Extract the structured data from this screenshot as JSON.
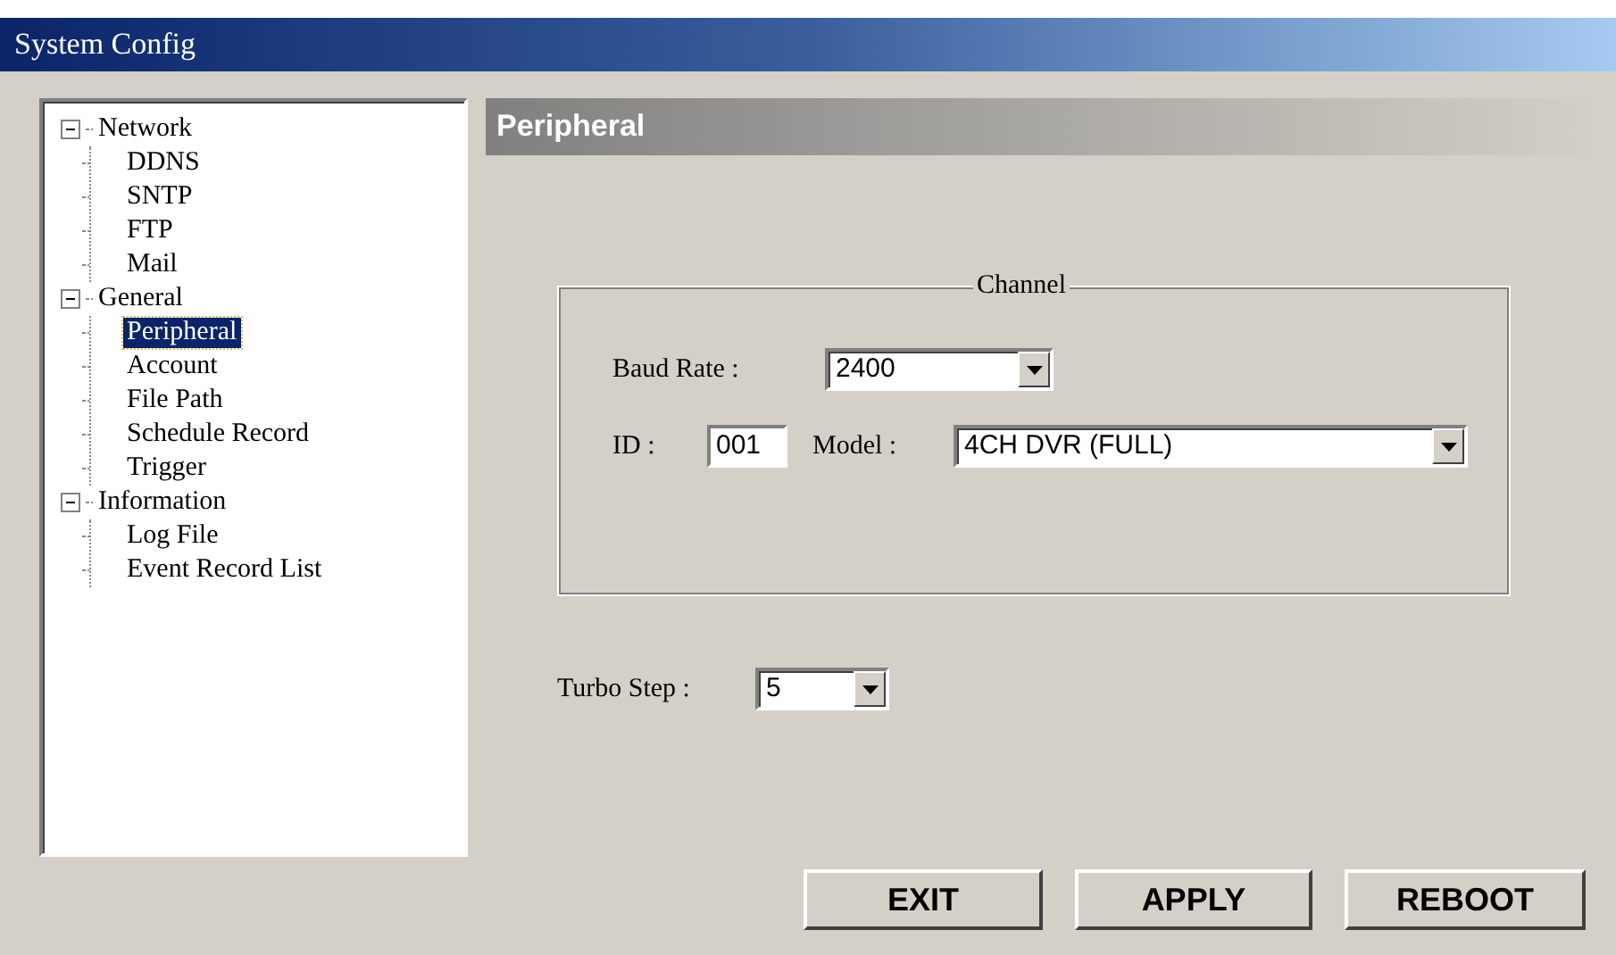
{
  "window": {
    "title": "System Config"
  },
  "tree": [
    {
      "label": "Network",
      "expanded": true,
      "children": [
        {
          "label": "DDNS",
          "selected": false
        },
        {
          "label": "SNTP",
          "selected": false
        },
        {
          "label": "FTP",
          "selected": false
        },
        {
          "label": "Mail",
          "selected": false
        }
      ]
    },
    {
      "label": "General",
      "expanded": true,
      "children": [
        {
          "label": "Peripheral",
          "selected": true
        },
        {
          "label": "Account",
          "selected": false
        },
        {
          "label": "File Path",
          "selected": false
        },
        {
          "label": "Schedule Record",
          "selected": false
        },
        {
          "label": "Trigger",
          "selected": false
        }
      ]
    },
    {
      "label": "Information",
      "expanded": true,
      "children": [
        {
          "label": "Log File",
          "selected": false
        },
        {
          "label": "Event Record List",
          "selected": false
        }
      ]
    }
  ],
  "panel": {
    "title": "Peripheral",
    "channel_group": {
      "title": "Channel",
      "baud_rate": {
        "label": "Baud Rate :",
        "value": "2400"
      },
      "id": {
        "label": "ID :",
        "value": "001"
      },
      "model": {
        "label": "Model :",
        "value": "4CH DVR (FULL)"
      }
    },
    "turbo_step": {
      "label": "Turbo Step :",
      "value": "5"
    }
  },
  "buttons": [
    "EXIT",
    "APPLY",
    "REBOOT"
  ]
}
